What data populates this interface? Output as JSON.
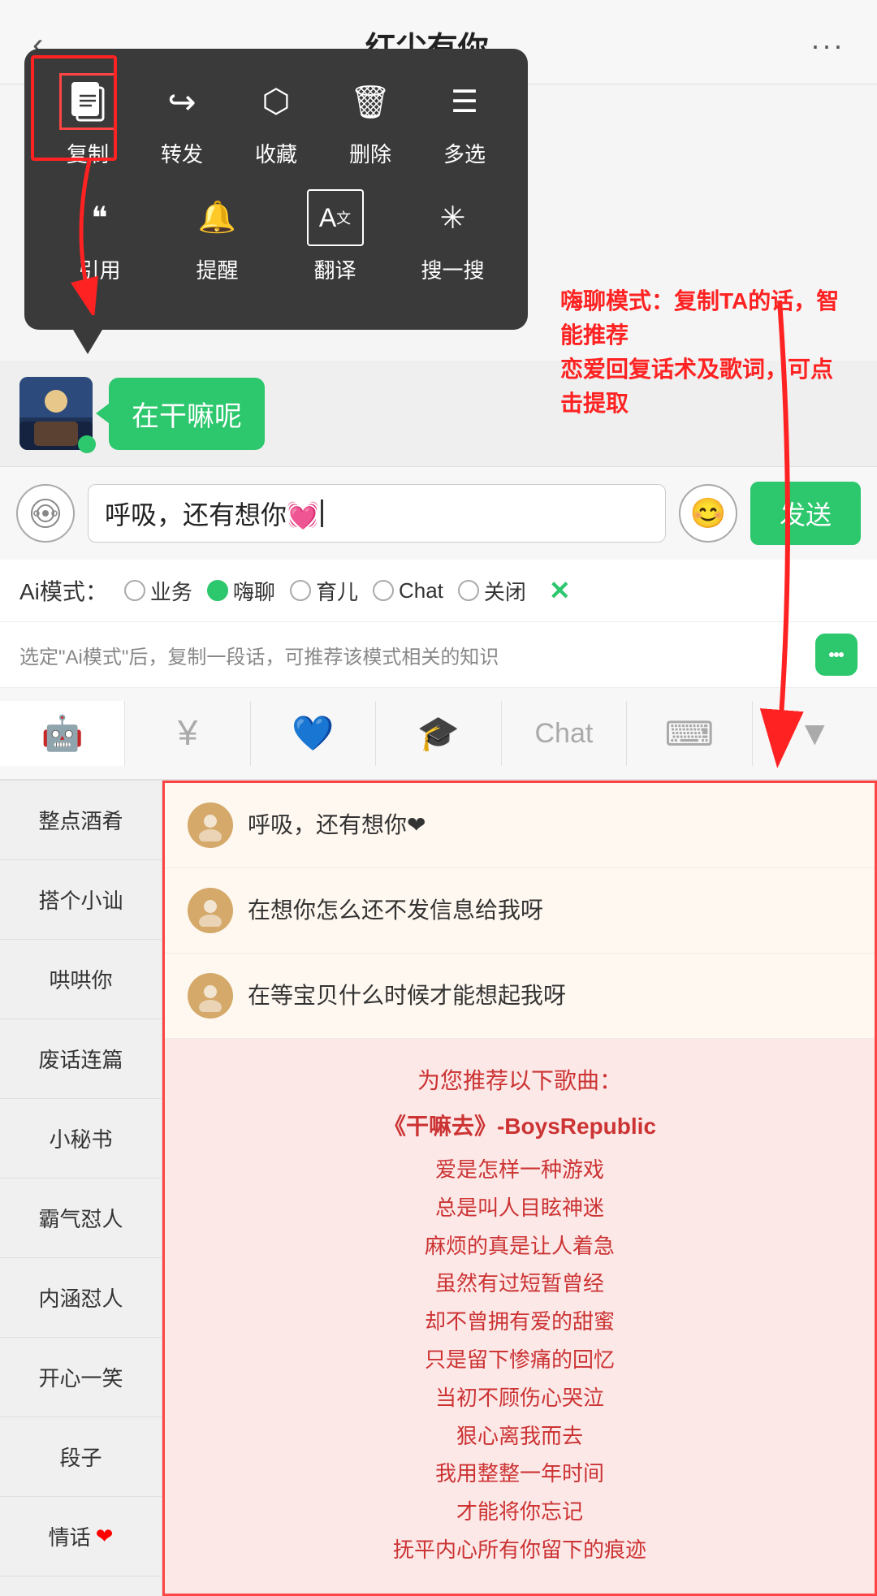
{
  "header": {
    "title": "红尘有你",
    "back_label": "‹",
    "more_label": "···"
  },
  "context_menu": {
    "items_row1": [
      {
        "icon": "📄",
        "label": "复制",
        "highlighted": true
      },
      {
        "icon": "↪",
        "label": "转发",
        "highlighted": false
      },
      {
        "icon": "📦",
        "label": "收藏",
        "highlighted": false
      },
      {
        "icon": "🗑",
        "label": "删除",
        "highlighted": false
      },
      {
        "icon": "☰",
        "label": "多选",
        "highlighted": false
      }
    ],
    "items_row2": [
      {
        "icon": "❝",
        "label": "引用",
        "highlighted": false
      },
      {
        "icon": "🔔",
        "label": "提醒",
        "highlighted": false
      },
      {
        "icon": "A",
        "label": "翻译",
        "highlighted": false
      },
      {
        "icon": "🔍",
        "label": "搜一搜",
        "highlighted": false
      }
    ]
  },
  "chat": {
    "bubble_text": "在干嘛呢"
  },
  "annotation": {
    "text": "嗨聊模式：复制TA的话，智能推荐\n恋爱回复话术及歌词，可点击提取"
  },
  "input": {
    "value": "呼吸，还有想你💓",
    "placeholder": "呼吸，还有想你💓"
  },
  "send_button": "发送",
  "ai_mode": {
    "label": "Ai模式：",
    "options": [
      {
        "label": "业务",
        "active": false
      },
      {
        "label": "嗨聊",
        "active": true
      },
      {
        "label": "育儿",
        "active": false
      },
      {
        "label": "Chat",
        "active": false
      },
      {
        "label": "关闭",
        "active": false
      }
    ],
    "close": "✕"
  },
  "info_bar": {
    "text": "选定\"Ai模式\"后，复制一段话，可推荐该模式相关的知识"
  },
  "toolbar": {
    "items": [
      {
        "icon": "🤖",
        "label": "chat",
        "active": true
      },
      {
        "icon": "¥",
        "label": "money"
      },
      {
        "icon": "💙",
        "label": "heart"
      },
      {
        "icon": "🎓",
        "label": "graduate"
      },
      {
        "icon": "Chat",
        "label": "chat-text"
      },
      {
        "icon": "⌨",
        "label": "keyboard"
      },
      {
        "icon": "▼",
        "label": "expand"
      }
    ]
  },
  "sidebar": {
    "items": [
      "整点酒肴",
      "搭个小讪",
      "哄哄你",
      "废话连篇",
      "小秘书",
      "霸气怼人",
      "内涵怼人",
      "开心一笑",
      "段子",
      "情话❤"
    ]
  },
  "suggestions": [
    {
      "text": "呼吸，还有想你❤"
    },
    {
      "text": "在想你怎么还不发信息给我呀"
    },
    {
      "text": "在等宝贝什么时候才能想起我呀"
    }
  ],
  "song_recommendation": {
    "title": "为您推荐以下歌曲：",
    "main_song": "《干嘛去》-BoysRepublic",
    "lyrics": [
      "爱是怎样一种游戏",
      "总是叫人目眩神迷",
      "麻烦的真是让人着急",
      "虽然有过短暂曾经",
      "却不曾拥有爱的甜蜜",
      "只是留下惨痛的回忆",
      "当初不顾伤心哭泣",
      "狠心离我而去",
      "我用整整一年时间",
      "才能将你忘记",
      "抚平内心所有你留下的痕迹"
    ]
  }
}
